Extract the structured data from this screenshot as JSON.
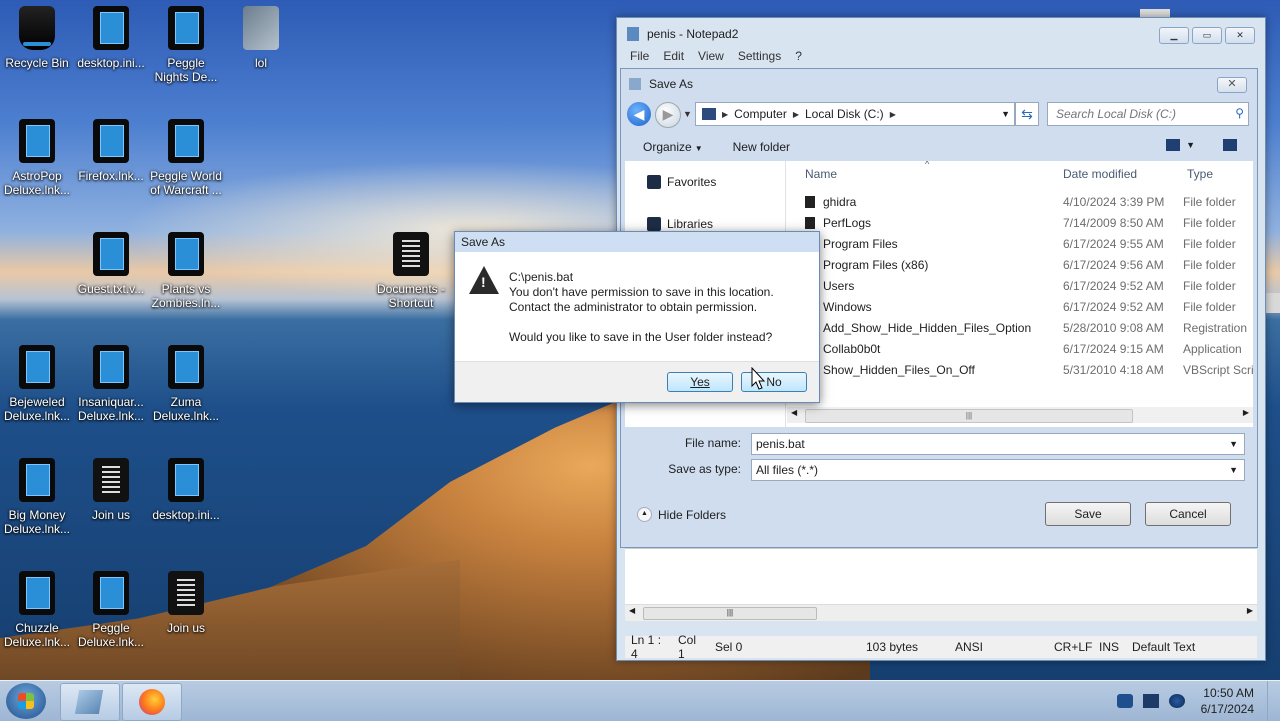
{
  "desktop": {
    "icons": [
      {
        "label": "Recycle Bin",
        "kind": "bin"
      },
      {
        "label": "desktop.ini...",
        "kind": "app"
      },
      {
        "label": "Peggle Nights De...",
        "kind": "app"
      },
      {
        "label": "lol",
        "kind": "lol"
      },
      {
        "label": "AstroPop Deluxe.lnk...",
        "kind": "app"
      },
      {
        "label": "Firefox.lnk...",
        "kind": "app"
      },
      {
        "label": "Peggle World of Warcraft ...",
        "kind": "app"
      },
      {
        "label": "Guest.txt.v...",
        "kind": "app"
      },
      {
        "label": "Plants vs Zombies.ln...",
        "kind": "app"
      },
      {
        "label": "Documents - Shortcut",
        "kind": "doc"
      },
      {
        "label": "Bejeweled Deluxe.lnk...",
        "kind": "app"
      },
      {
        "label": "Insaniquar... Deluxe.lnk...",
        "kind": "app"
      },
      {
        "label": "Zuma Deluxe.lnk...",
        "kind": "app"
      },
      {
        "label": "Big Money Deluxe.lnk...",
        "kind": "app"
      },
      {
        "label": "Join us",
        "kind": "doc"
      },
      {
        "label": "desktop.ini...",
        "kind": "app"
      },
      {
        "label": "Chuzzle Deluxe.lnk...",
        "kind": "app"
      },
      {
        "label": "Peggle Deluxe.lnk...",
        "kind": "app"
      },
      {
        "label": "Join us",
        "kind": "doc"
      }
    ]
  },
  "notepad": {
    "title": "penis - Notepad2",
    "menu": [
      "File",
      "Edit",
      "View",
      "Settings",
      "?"
    ],
    "status": {
      "position": "Ln 1 : 4",
      "col": "Col 1",
      "sel": "Sel 0",
      "size": "103 bytes",
      "encoding": "ANSI",
      "line_ending": "CR+LF",
      "mode": "INS",
      "scheme": "Default Text"
    }
  },
  "save_as": {
    "title": "Save As",
    "address": [
      "Computer",
      "Local Disk (C:)"
    ],
    "search_placeholder": "Search Local Disk (C:)",
    "toolbar": {
      "organize": "Organize",
      "new_folder": "New folder"
    },
    "nav": {
      "favorites": "Favorites",
      "libraries": "Libraries"
    },
    "columns": {
      "name": "Name",
      "date": "Date modified",
      "type": "Type"
    },
    "files": [
      {
        "name": "ghidra",
        "date": "4/10/2024 3:39 PM",
        "type": "File folder"
      },
      {
        "name": "PerfLogs",
        "date": "7/14/2009 8:50 AM",
        "type": "File folder"
      },
      {
        "name": "Program Files",
        "date": "6/17/2024 9:55 AM",
        "type": "File folder"
      },
      {
        "name": "Program Files (x86)",
        "date": "6/17/2024 9:56 AM",
        "type": "File folder"
      },
      {
        "name": "Users",
        "date": "6/17/2024 9:52 AM",
        "type": "File folder"
      },
      {
        "name": "Windows",
        "date": "6/17/2024 9:52 AM",
        "type": "File folder"
      },
      {
        "name": "Add_Show_Hide_Hidden_Files_Option",
        "date": "5/28/2010 9:08 AM",
        "type": "Registration"
      },
      {
        "name": "Collab0b0t",
        "date": "6/17/2024 9:15 AM",
        "type": "Application"
      },
      {
        "name": "Show_Hidden_Files_On_Off",
        "date": "5/31/2010 4:18 AM",
        "type": "VBScript Scri"
      }
    ],
    "file_name_label": "File name:",
    "file_name_value": "penis.bat",
    "save_type_label": "Save as type:",
    "save_type_value": "All files (*.*)",
    "hide_folders": "Hide Folders",
    "save": "Save",
    "cancel": "Cancel"
  },
  "warning": {
    "title": "Save As",
    "path": "C:\\penis.bat",
    "line1": "You don't have permission to save in this location.",
    "line2": "Contact the administrator to obtain permission.",
    "question": "Would you like to save in the User folder instead?",
    "yes": "Yes",
    "no": "No"
  },
  "taskbar": {
    "time": "10:50 AM",
    "date": "6/17/2024"
  }
}
